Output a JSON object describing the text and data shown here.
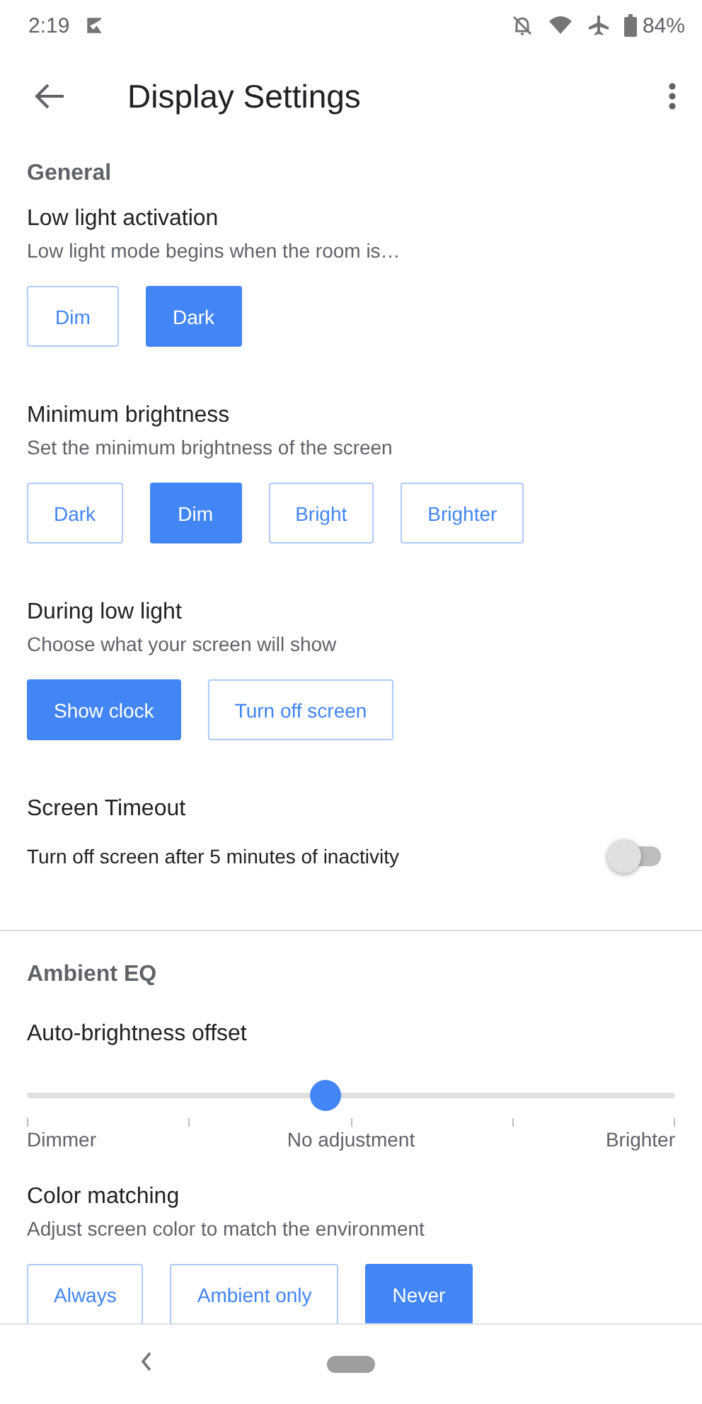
{
  "status_bar": {
    "time": "2:19",
    "battery": "84%"
  },
  "app_bar": {
    "title": "Display Settings"
  },
  "sections": [
    {
      "header": "General",
      "items": [
        {
          "kind": "choice",
          "title": "Low light activation",
          "subtitle": "Low light mode begins when the room is…",
          "options": [
            {
              "label": "Dim",
              "selected": false
            },
            {
              "label": "Dark",
              "selected": true
            }
          ]
        },
        {
          "kind": "choice",
          "title": "Minimum brightness",
          "subtitle": "Set the minimum brightness of the screen",
          "options": [
            {
              "label": "Dark",
              "selected": false
            },
            {
              "label": "Dim",
              "selected": true
            },
            {
              "label": "Bright",
              "selected": false
            },
            {
              "label": "Brighter",
              "selected": false
            }
          ]
        },
        {
          "kind": "choice",
          "title": "During low light",
          "subtitle": "Choose what your screen will show",
          "options": [
            {
              "label": "Show clock",
              "selected": true
            },
            {
              "label": "Turn off screen",
              "selected": false
            }
          ]
        },
        {
          "kind": "toggle",
          "title": "Screen Timeout",
          "subtitle": "Turn off screen after 5 minutes of inactivity",
          "on": false
        }
      ]
    },
    {
      "header": "Ambient EQ",
      "items": [
        {
          "kind": "slider",
          "title": "Auto-brightness offset",
          "level": 0.46,
          "labels": [
            "Dimmer",
            "No adjustment",
            "Brighter"
          ]
        },
        {
          "kind": "choice",
          "title": "Color matching",
          "subtitle": "Adjust screen color to match the environment",
          "options": [
            {
              "label": "Always",
              "selected": false
            },
            {
              "label": "Ambient only",
              "selected": false
            },
            {
              "label": "Never",
              "selected": true
            }
          ]
        }
      ]
    }
  ]
}
